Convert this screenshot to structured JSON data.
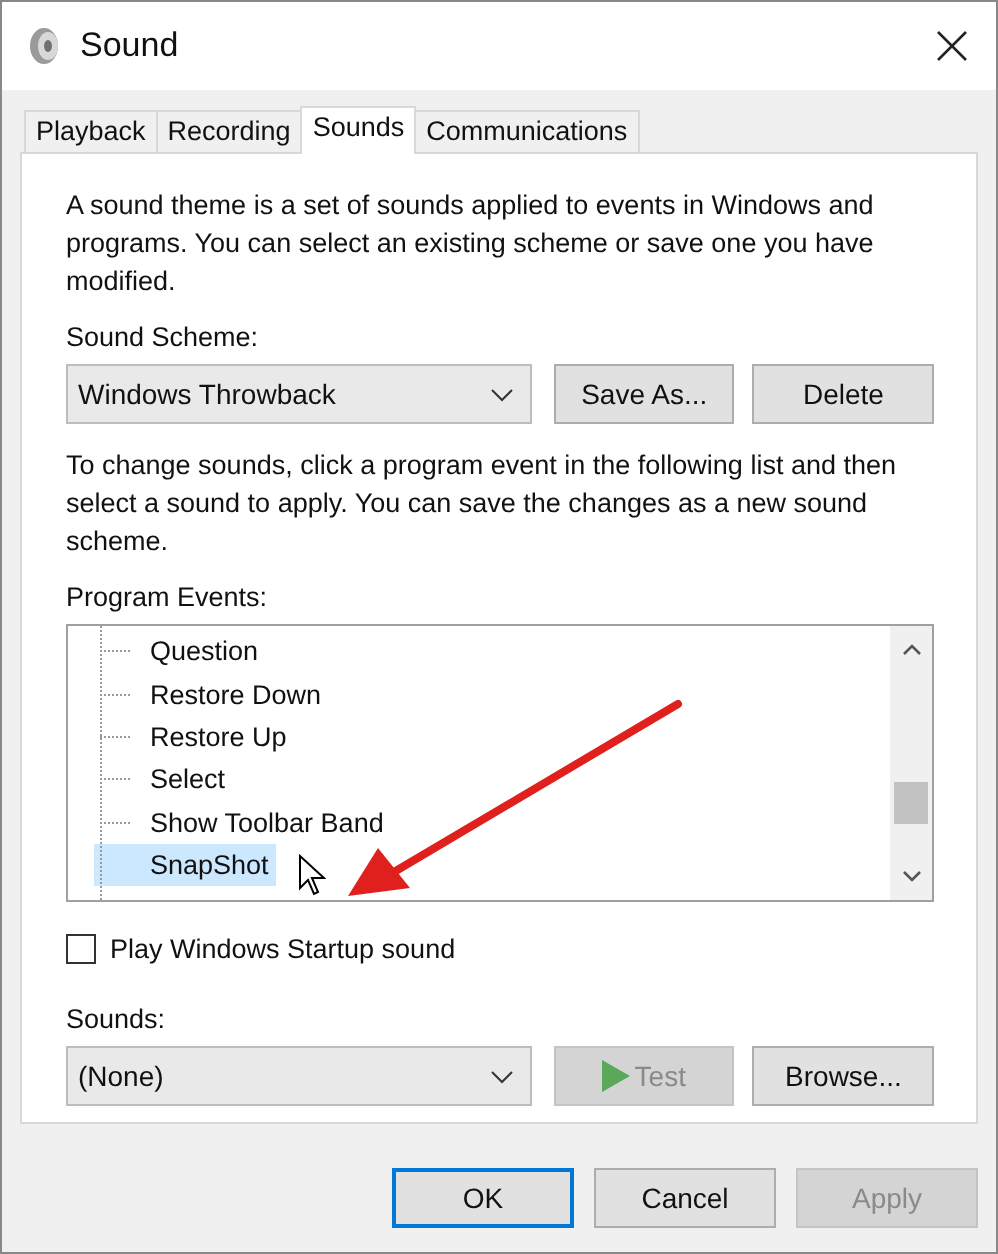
{
  "window": {
    "title": "Sound"
  },
  "tabs": [
    {
      "label": "Playback",
      "selected": false
    },
    {
      "label": "Recording",
      "selected": false
    },
    {
      "label": "Sounds",
      "selected": true
    },
    {
      "label": "Communications",
      "selected": false
    }
  ],
  "intro": "A sound theme is a set of sounds applied to events in Windows and programs.  You can select an existing scheme or save one you have modified.",
  "sound_scheme": {
    "label": "Sound Scheme:",
    "value": "Windows Throwback",
    "buttons": [
      {
        "label": "Save As...",
        "disabled": false
      },
      {
        "label": "Delete",
        "disabled": false
      }
    ]
  },
  "instructions": "To change sounds, click a program event in the following list and then select a sound to apply.  You can save the changes as a new sound scheme.",
  "program_events": {
    "label": "Program Events:",
    "items": [
      {
        "label": "Question",
        "selected": false
      },
      {
        "label": "Restore Down",
        "selected": false
      },
      {
        "label": "Restore Up",
        "selected": false
      },
      {
        "label": "Select",
        "selected": false
      },
      {
        "label": "Show Toolbar Band",
        "selected": false
      },
      {
        "label": "SnapShot",
        "selected": true
      }
    ]
  },
  "startup_sound": {
    "label": "Play Windows Startup sound",
    "checked": false
  },
  "sounds": {
    "label": "Sounds:",
    "value": "(None)",
    "test": {
      "label": "Test",
      "disabled": true
    },
    "browse": {
      "label": "Browse...",
      "disabled": false
    }
  },
  "buttons": [
    {
      "label": "OK",
      "default": true,
      "disabled": false
    },
    {
      "label": "Cancel",
      "default": false,
      "disabled": false
    },
    {
      "label": "Apply",
      "default": false,
      "disabled": true
    }
  ]
}
